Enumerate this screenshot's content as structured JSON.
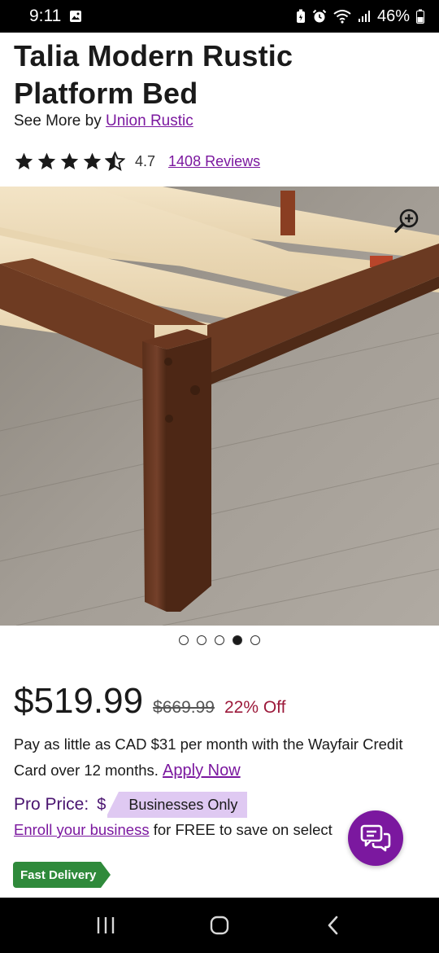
{
  "status_bar": {
    "time": "9:11",
    "battery": "46%",
    "icons": [
      "gallery-icon",
      "battery-saver-icon",
      "alarm-icon",
      "wifi-icon",
      "signal-icon",
      "battery-icon"
    ]
  },
  "product": {
    "title": "Talia Modern Rustic Platform Bed",
    "see_more_prefix": "See More by",
    "brand": "Union Rustic",
    "rating_value": "4.7",
    "rating": 4.7,
    "reviews_label": "1408 Reviews",
    "image_alt": "Wooden platform bed frame corner with light slats on wood floor",
    "gallery": {
      "count": 5,
      "active_index": 3
    }
  },
  "pricing": {
    "price": "$519.99",
    "old_price": "$669.99",
    "discount": "22% Off",
    "credit_text": "Pay as little as CAD $31 per month with the Wayfair Credit Card over 12 months.",
    "apply_now": "Apply Now",
    "pro_label": "Pro Price:",
    "pro_dollar": "$",
    "businesses_only": "Businesses Only",
    "enroll_link": "Enroll your business",
    "enroll_suffix": "for FREE to save on select"
  },
  "badges": {
    "fast_delivery": "Fast Delivery"
  },
  "colors": {
    "link": "#7b189f",
    "accent": "#7b189f",
    "discount": "#9c1a3b",
    "fast_delivery": "#2f8a3b",
    "pro_badge": "#dfc9f2"
  },
  "nav": {
    "icons": [
      "recent-apps-icon",
      "home-icon",
      "back-icon"
    ]
  }
}
